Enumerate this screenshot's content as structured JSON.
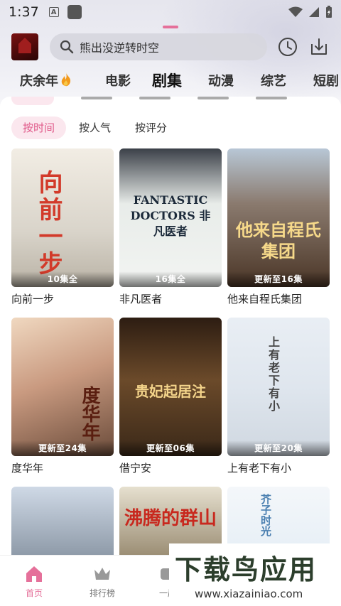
{
  "status_bar": {
    "time": "1:37",
    "a_badge": "A"
  },
  "header": {
    "search_placeholder": "熊出没逆转时空"
  },
  "category_tabs": [
    {
      "label": "庆余年"
    },
    {
      "label": "电影"
    },
    {
      "label": "剧集"
    },
    {
      "label": "动漫"
    },
    {
      "label": "综艺"
    },
    {
      "label": "短剧"
    }
  ],
  "active_category": "剧集",
  "sort_options": [
    {
      "label": "按时间"
    },
    {
      "label": "按人气"
    },
    {
      "label": "按评分"
    }
  ],
  "active_sort": "按时间",
  "shows": [
    {
      "title": "向前一步",
      "badge": "10集全",
      "poster_text": "向前一步"
    },
    {
      "title": "非凡医者",
      "badge": "16集全",
      "poster_text": "FANTASTIC DOCTORS 非凡医者"
    },
    {
      "title": "他来自程氏集团",
      "badge": "更新至16集",
      "poster_text": "他来自程氏集团"
    },
    {
      "title": "度华年",
      "badge": "更新至24集",
      "poster_text": "度华年"
    },
    {
      "title": "借宁安",
      "badge": "更新至06集",
      "poster_text": "贵妃起居注"
    },
    {
      "title": "上有老下有小",
      "badge": "更新至20集",
      "poster_text": "上有老下有小"
    },
    {
      "title": "",
      "badge": "",
      "poster_text": ""
    },
    {
      "title": "",
      "badge": "",
      "poster_text": "沸腾的群山"
    },
    {
      "title": "",
      "badge": "",
      "poster_text": "芥子时光"
    }
  ],
  "bottom_nav": [
    {
      "label": "首页"
    },
    {
      "label": "排行榜"
    },
    {
      "label": "一起"
    }
  ],
  "watermark": {
    "main": "下载鸟应用",
    "url": "www.xiazainiao.com"
  },
  "colors": {
    "accent": "#e5709a",
    "accent_bg": "#fbe7ee"
  }
}
